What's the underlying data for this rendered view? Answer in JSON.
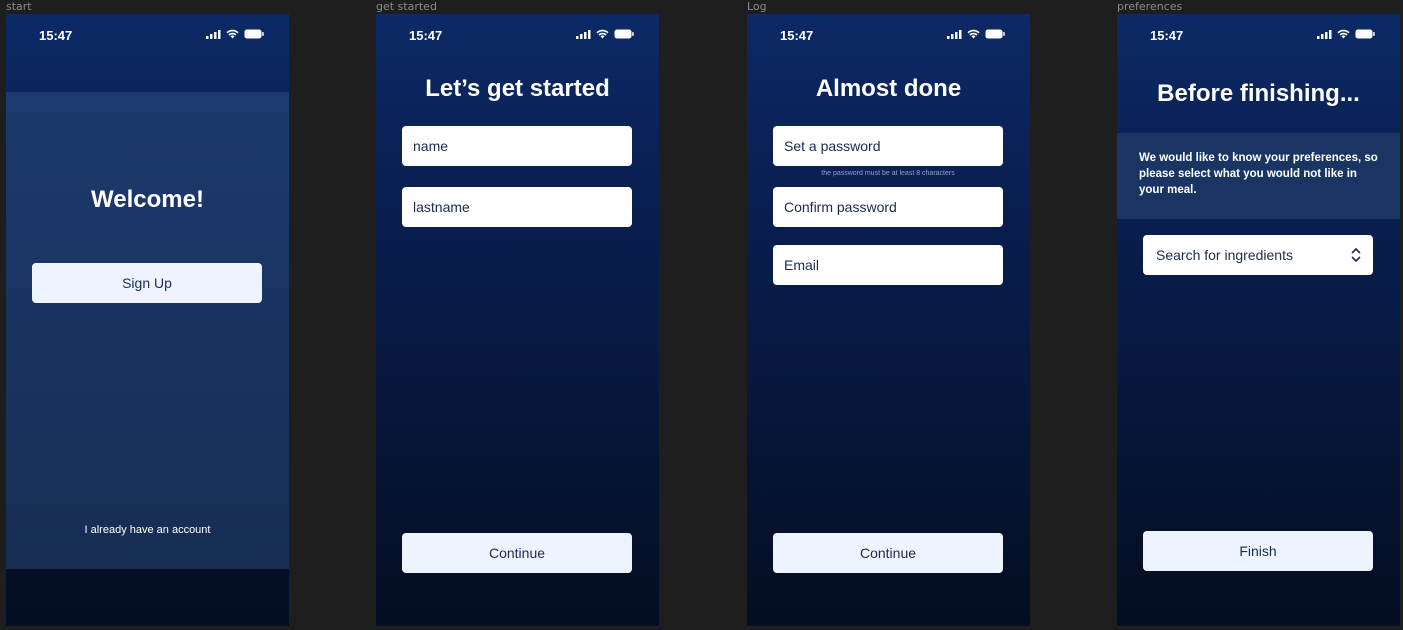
{
  "frames": [
    {
      "label": "start"
    },
    {
      "label": "get started"
    },
    {
      "label": "Log"
    },
    {
      "label": "preferences"
    }
  ],
  "status": {
    "time": "15:47"
  },
  "start": {
    "title": "Welcome!",
    "signup_label": "Sign Up",
    "account_link": "I already have an account"
  },
  "get_started": {
    "title": "Let’s get started",
    "name_placeholder": "name",
    "lastname_placeholder": "lastname",
    "continue_label": "Continue"
  },
  "log": {
    "title": "Almost done",
    "password_placeholder": "Set a password",
    "password_hint": "the password must be at least 8 characters",
    "confirm_placeholder": "Confirm password",
    "email_placeholder": "Email",
    "continue_label": "Continue"
  },
  "preferences": {
    "title": "Before finishing...",
    "description": "We would like to know your preferences, so please select what you would not like in your meal.",
    "search_placeholder": "Search for ingredients",
    "finish_label": "Finish"
  },
  "icons": [
    "signal-icon",
    "wifi-icon",
    "battery-icon",
    "chevron-updown-icon"
  ]
}
